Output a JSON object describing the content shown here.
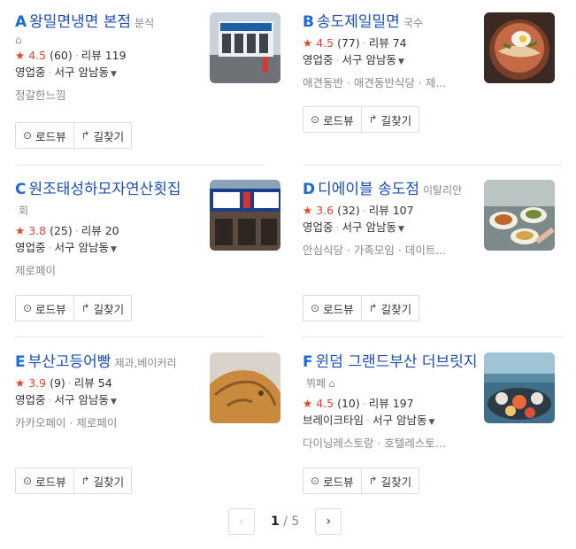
{
  "results": [
    {
      "letter": "A",
      "name": "왕밀면냉면 본점",
      "category": "분식",
      "has_home_icon": true,
      "rating": "4.5",
      "rating_count": "(60)",
      "reviews": "리뷰 119",
      "status": "영업중",
      "location": "서구 암남동",
      "tags": "정갈한느낌",
      "buttons": {
        "roadview": "로드뷰",
        "directions": "길찾기"
      },
      "thumb_icon": "restaurant-storefront-photo"
    },
    {
      "letter": "B",
      "name": "송도제일밀면",
      "category": "국수",
      "has_home_icon": false,
      "rating": "4.5",
      "rating_count": "(77)",
      "reviews": "리뷰 74",
      "status": "영업중",
      "location": "서구 암남동",
      "tags": "애견동반 · 애견동반식당 · 제...",
      "buttons": {
        "roadview": "로드뷰",
        "directions": "길찾기"
      },
      "thumb_icon": "naengmyeon-bowl-photo"
    },
    {
      "letter": "C",
      "name": "원조태성하모자연산횟집",
      "category": "회",
      "has_home_icon": false,
      "rating": "3.8",
      "rating_count": "(25)",
      "reviews": "리뷰 20",
      "status": "영업중",
      "location": "서구 암남동",
      "tags": "제로페이",
      "buttons": {
        "roadview": "로드뷰",
        "directions": "길찾기"
      },
      "thumb_icon": "restaurant-signboard-photo"
    },
    {
      "letter": "D",
      "name": "디에이블 송도점",
      "category": "이탈리안",
      "has_home_icon": false,
      "rating": "3.6",
      "rating_count": "(32)",
      "reviews": "리뷰 107",
      "status": "영업중",
      "location": "서구 암남동",
      "tags": "안심식당 · 가족모임 · 데이트...",
      "buttons": {
        "roadview": "로드뷰",
        "directions": "길찾기"
      },
      "thumb_icon": "food-table-photo"
    },
    {
      "letter": "E",
      "name": "부산고등어빵",
      "category": "제과,베이커리",
      "has_home_icon": false,
      "rating": "3.9",
      "rating_count": "(9)",
      "reviews": "리뷰 54",
      "status": "영업중",
      "location": "서구 암남동",
      "tags": "카카오페이 · 제로페이",
      "buttons": {
        "roadview": "로드뷰",
        "directions": "길찾기"
      },
      "thumb_icon": "fish-bread-photo"
    },
    {
      "letter": "F",
      "name": "윈덤 그랜드부산 더브릿지",
      "category": "뷔페",
      "has_home_icon": true,
      "rating": "4.5",
      "rating_count": "(10)",
      "reviews": "리뷰 197",
      "status": "브레이크타임",
      "location": "서구 암남동",
      "tags": "다이닝레스토랑 · 호텔레스토...",
      "buttons": {
        "roadview": "로드뷰",
        "directions": "길찾기"
      },
      "thumb_icon": "buffet-seafood-photo"
    }
  ],
  "pagination": {
    "current": "1",
    "separator": "/",
    "total": "5",
    "prev": "‹",
    "next": "›"
  }
}
